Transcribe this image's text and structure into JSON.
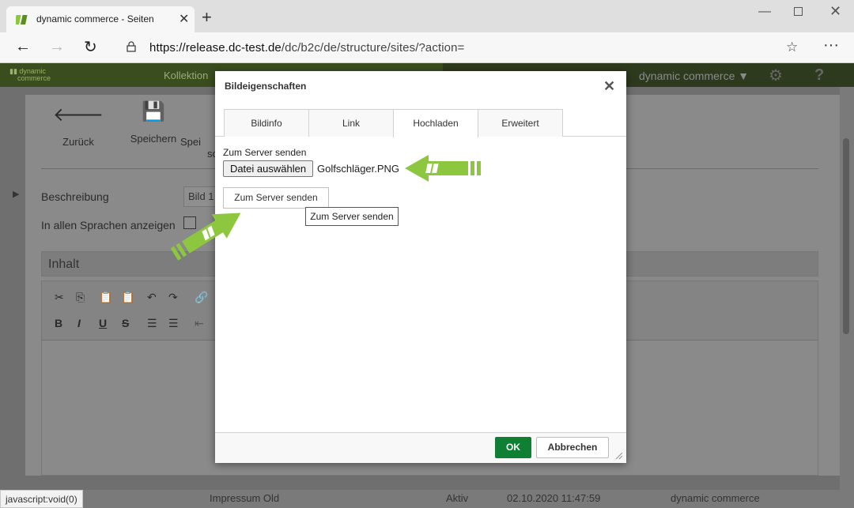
{
  "browser": {
    "tab_title": "dynamic commerce - Seiten",
    "new_tab_icon": "plus-icon",
    "url_host": "https://release.dc-test.de",
    "url_path": "/dc/b2c/de/structure/sites/?action=",
    "status_text": "javascript:void(0)"
  },
  "app": {
    "header_nav": "Kollektion",
    "user": "dynamic commerce ▼",
    "toolbar": {
      "back": "Zurück",
      "save": "Speichern",
      "save_close": "Spei",
      "save_close_2": "sc"
    },
    "description_label": "Beschreibung",
    "description_value": "Bild 1",
    "all_languages_label": "In allen Sprachen anzeigen",
    "content_title": "Inhalt",
    "footer": {
      "name": "Impressum Old",
      "status": "Aktiv",
      "date": "02.10.2020 11:47:59",
      "owner": "dynamic commerce"
    }
  },
  "dialog": {
    "title": "Bildeigenschaften",
    "tabs": [
      "Bildinfo",
      "Link",
      "Hochladen",
      "Erweitert"
    ],
    "active_tab": "Hochladen",
    "upload_label": "Zum Server senden",
    "file_button": "Datei auswählen",
    "file_name": "Golfschläger.PNG",
    "send_button": "Zum Server senden",
    "tooltip": "Zum Server senden",
    "ok_button": "OK",
    "cancel_button": "Abbrechen"
  },
  "colors": {
    "ok_green": "#0e7f33",
    "arrow_green": "#8dc63f"
  }
}
